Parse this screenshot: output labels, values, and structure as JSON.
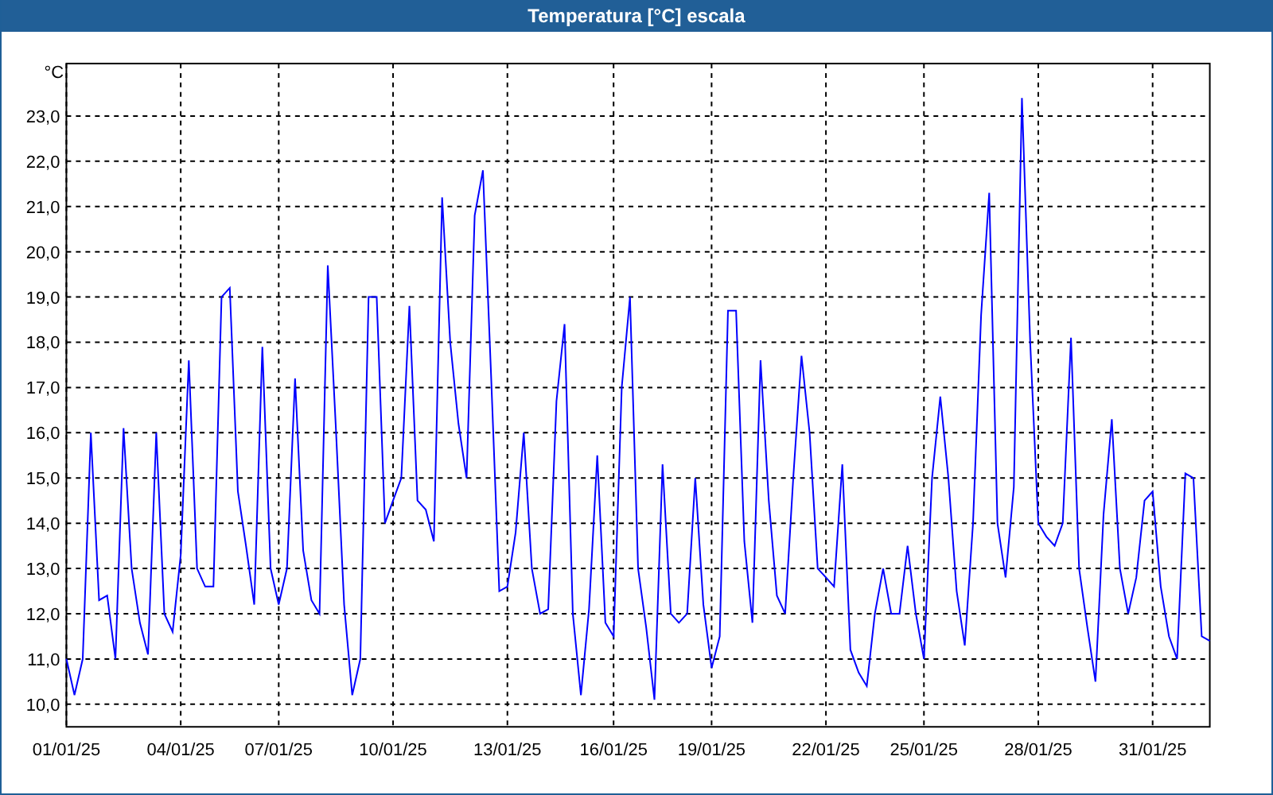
{
  "window": {
    "title": "Temperatura [°C] escala"
  },
  "chart": {
    "chart_data": {
      "type": "line",
      "grid": true,
      "ylabel": "°C",
      "ylim": [
        9.5,
        24.16
      ],
      "yticks": [
        {
          "value": 10,
          "label": "10,0"
        },
        {
          "value": 11,
          "label": "11,0"
        },
        {
          "value": 12,
          "label": "12,0"
        },
        {
          "value": 13,
          "label": "13,0"
        },
        {
          "value": 14,
          "label": "14,0"
        },
        {
          "value": 15,
          "label": "15,0"
        },
        {
          "value": 16,
          "label": "16,0"
        },
        {
          "value": 17,
          "label": "17,0"
        },
        {
          "value": 18,
          "label": "18,0"
        },
        {
          "value": 19,
          "label": "19,0"
        },
        {
          "value": 20,
          "label": "20,0"
        },
        {
          "value": 21,
          "label": "21,0"
        },
        {
          "value": 22,
          "label": "22,0"
        },
        {
          "value": 23,
          "label": "23,0"
        }
      ],
      "categories": [
        "01/01/25",
        null,
        null,
        null,
        null,
        null,
        null,
        null,
        null,
        null,
        null,
        null,
        null,
        null,
        "04/01/25",
        null,
        null,
        null,
        null,
        null,
        null,
        null,
        null,
        null,
        null,
        null,
        "07/01/25",
        null,
        null,
        null,
        null,
        null,
        null,
        null,
        null,
        null,
        null,
        null,
        null,
        null,
        "10/01/25",
        null,
        null,
        null,
        null,
        null,
        null,
        null,
        null,
        null,
        null,
        null,
        null,
        null,
        "13/01/25",
        null,
        null,
        null,
        null,
        null,
        null,
        null,
        null,
        null,
        null,
        null,
        null,
        "16/01/25",
        null,
        null,
        null,
        null,
        null,
        null,
        null,
        null,
        null,
        null,
        null,
        "19/01/25",
        null,
        null,
        null,
        null,
        null,
        null,
        null,
        null,
        null,
        null,
        null,
        null,
        null,
        "22/01/25",
        null,
        null,
        null,
        null,
        null,
        null,
        null,
        null,
        null,
        null,
        null,
        "25/01/25",
        null,
        null,
        null,
        null,
        null,
        null,
        null,
        null,
        null,
        null,
        null,
        null,
        null,
        "28/01/25",
        null,
        null,
        null,
        null,
        null,
        null,
        null,
        null,
        null,
        null,
        null,
        null,
        null,
        "31/01/25",
        null,
        null,
        null,
        null,
        null,
        null,
        null
      ],
      "series": [
        {
          "color": "#0000ff",
          "values": [
            11.0,
            10.2,
            11.0,
            16.0,
            12.3,
            12.4,
            11.0,
            16.1,
            13.0,
            11.8,
            11.1,
            16.0,
            12.0,
            11.6,
            13.3,
            17.6,
            13.0,
            12.6,
            12.6,
            19.0,
            19.2,
            14.7,
            13.5,
            12.2,
            17.9,
            13.0,
            12.2,
            13.0,
            17.2,
            13.4,
            12.3,
            12.0,
            19.7,
            16.1,
            12.2,
            10.2,
            11.0,
            19.0,
            19.0,
            14.0,
            14.5,
            15.0,
            18.8,
            14.5,
            14.3,
            13.6,
            21.2,
            18.0,
            16.2,
            15.0,
            20.8,
            21.8,
            17.3,
            12.5,
            12.6,
            13.8,
            16.0,
            13.0,
            12.0,
            12.1,
            16.7,
            18.4,
            12.0,
            10.2,
            12.1,
            15.5,
            11.8,
            11.5,
            17.0,
            19.0,
            13.0,
            11.7,
            10.1,
            15.3,
            12.0,
            11.8,
            12.0,
            15.0,
            12.2,
            10.8,
            11.5,
            18.7,
            18.7,
            13.6,
            11.8,
            17.6,
            14.5,
            12.4,
            12.0,
            15.0,
            17.7,
            16.0,
            13.0,
            12.8,
            12.6,
            15.3,
            11.2,
            10.7,
            10.4,
            12.0,
            13.0,
            12.0,
            12.0,
            13.5,
            12.0,
            11.0,
            15.0,
            16.8,
            15.0,
            12.5,
            11.3,
            14.0,
            18.6,
            21.3,
            14.0,
            12.8,
            14.8,
            23.4,
            18.0,
            14.0,
            13.7,
            13.5,
            14.0,
            18.1,
            13.0,
            11.7,
            10.5,
            14.2,
            16.3,
            13.0,
            12.0,
            12.8,
            14.5,
            14.7,
            12.6,
            11.5,
            11.0,
            15.1,
            15.0,
            11.5,
            11.4
          ]
        }
      ]
    }
  }
}
